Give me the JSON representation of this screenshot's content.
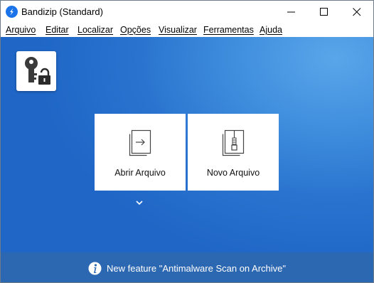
{
  "window": {
    "title": "Bandizip (Standard)"
  },
  "menu": [
    {
      "label": "Arquivo"
    },
    {
      "label": "Editar"
    },
    {
      "label": "Localizar"
    },
    {
      "label": "Opções"
    },
    {
      "label": "Visualizar"
    },
    {
      "label": "Ferramentas"
    },
    {
      "label": "Ajuda"
    }
  ],
  "tiles": {
    "open": {
      "label": "Abrir Arquivo",
      "icon": "open-archive-icon"
    },
    "new": {
      "label": "Novo Arquivo",
      "icon": "new-archive-icon"
    }
  },
  "status": {
    "text": "New feature \"Antimalware Scan on Archive\"",
    "icon": "info-icon"
  },
  "colors": {
    "background_blue": "#2a74cf",
    "status_bar": "#2c67b2",
    "tile": "#ffffff"
  }
}
